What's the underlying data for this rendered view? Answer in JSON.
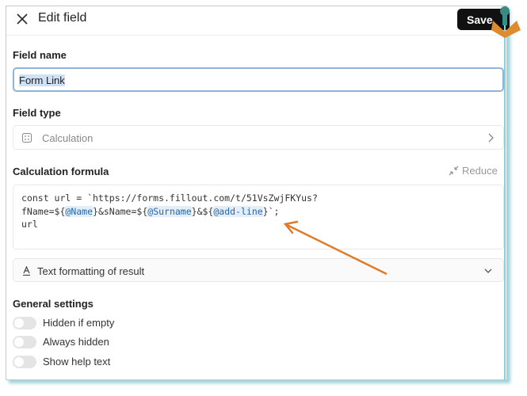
{
  "header": {
    "title": "Edit field",
    "save_label": "Save"
  },
  "field_name": {
    "label": "Field name",
    "value": "Form Link"
  },
  "field_type": {
    "label": "Field type",
    "value": "Calculation"
  },
  "formula": {
    "label": "Calculation formula",
    "reduce_label": "Reduce",
    "line1": "const url = `https://forms.fillout.com/t/51VsZwjFKYus?",
    "line2_parts": [
      "fName=${",
      "@Name",
      "}&sName=${",
      "@Surname",
      "}&${",
      "@add-line",
      "}`;"
    ],
    "line3": "url"
  },
  "text_formatting": {
    "label": "Text formatting of result"
  },
  "general_settings": {
    "label": "General settings",
    "toggles": [
      {
        "label": "Hidden if empty",
        "on": false
      },
      {
        "label": "Always hidden",
        "on": false
      },
      {
        "label": "Show help text",
        "on": false
      }
    ]
  },
  "colors": {
    "accent_annotation": "#e07b2a",
    "token_bg": "#e3eef8",
    "token_text": "#2468b0",
    "shadow": "#9fd3da"
  }
}
